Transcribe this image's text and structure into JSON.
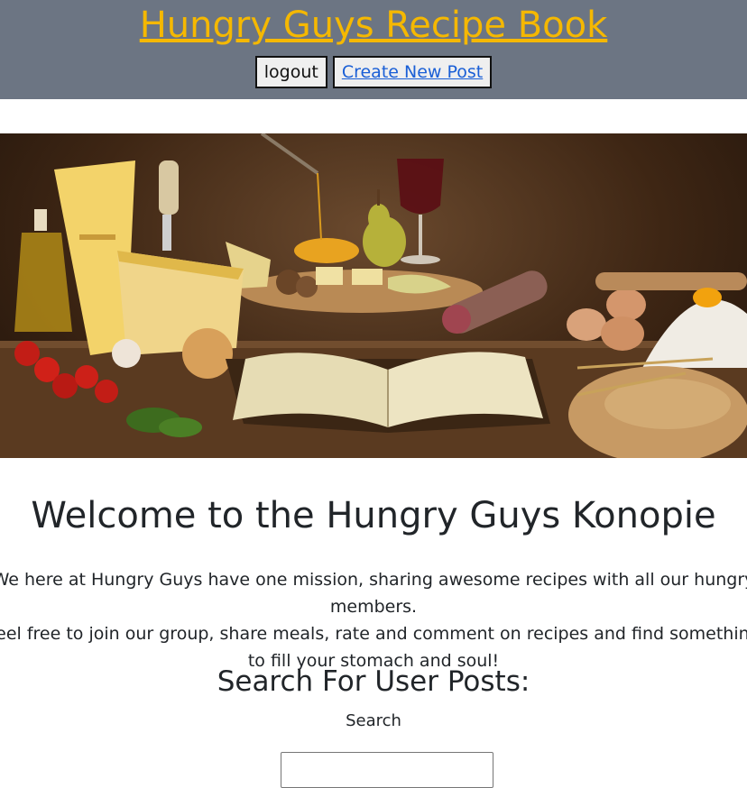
{
  "header": {
    "title": "Hungry Guys Recipe Book",
    "logout_label": "logout",
    "create_post_label": "Create New Post"
  },
  "hero": {
    "description": "Banner image of cooking ingredients and an open recipe book"
  },
  "main": {
    "welcome_heading": "Welcome to the Hungry Guys Konopie",
    "mission_line1": "We here at Hungry Guys have one mission, sharing awesome recipes with all our hungry members.",
    "mission_line2": "Feel free to join our group, share meals, rate and comment on recipes and find something",
    "mission_line3": "to fill your stomach and soul!",
    "search_heading": "Search For User Posts:",
    "search_label": "Search",
    "search_value": ""
  },
  "colors": {
    "header_bg": "#6c7583",
    "title_color": "#f5b800",
    "link_color": "#1a5fd6",
    "text_color": "#212529"
  }
}
